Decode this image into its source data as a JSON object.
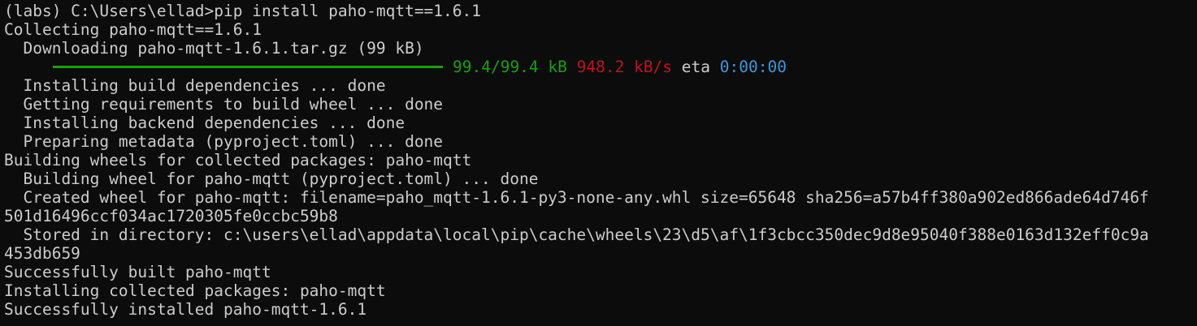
{
  "terminal": {
    "colors": {
      "background": "#0c0c0c",
      "foreground": "#cccccc",
      "green": "#13a10e",
      "red": "#c50f1f",
      "blue": "#3a96dd"
    },
    "lines": {
      "l01": "(labs) C:\\Users\\ellad>pip install paho-mqtt==1.6.1",
      "l02": "Collecting paho-mqtt==1.6.1",
      "l03": "  Downloading paho-mqtt-1.6.1.tar.gz (99 kB)",
      "l05": "  Installing build dependencies ... done",
      "l06": "  Getting requirements to build wheel ... done",
      "l07": "  Installing backend dependencies ... done",
      "l08": "  Preparing metadata (pyproject.toml) ... done",
      "l09": "Building wheels for collected packages: paho-mqtt",
      "l10": "  Building wheel for paho-mqtt (pyproject.toml) ... done",
      "l11": "  Created wheel for paho-mqtt: filename=paho_mqtt-1.6.1-py3-none-any.whl size=65648 sha256=a57b4ff380a902ed866ade64d746f",
      "l12": "501d16496ccf034ac1720305fe0ccbc59b8",
      "l13": "  Stored in directory: c:\\users\\ellad\\appdata\\local\\pip\\cache\\wheels\\23\\d5\\af\\1f3cbcc350dec9d8e95040f388e0163d132eff0c9a",
      "l14": "453db659",
      "l15": "Successfully built paho-mqtt",
      "l16": "Installing collected packages: paho-mqtt",
      "l17": "Successfully installed paho-mqtt-1.6.1"
    },
    "progress": {
      "fraction": 1.0,
      "size": "99.4/99.4 kB",
      "speed": "948.2 kB/s",
      "eta_label": "eta",
      "eta_value": "0:00:00"
    }
  }
}
